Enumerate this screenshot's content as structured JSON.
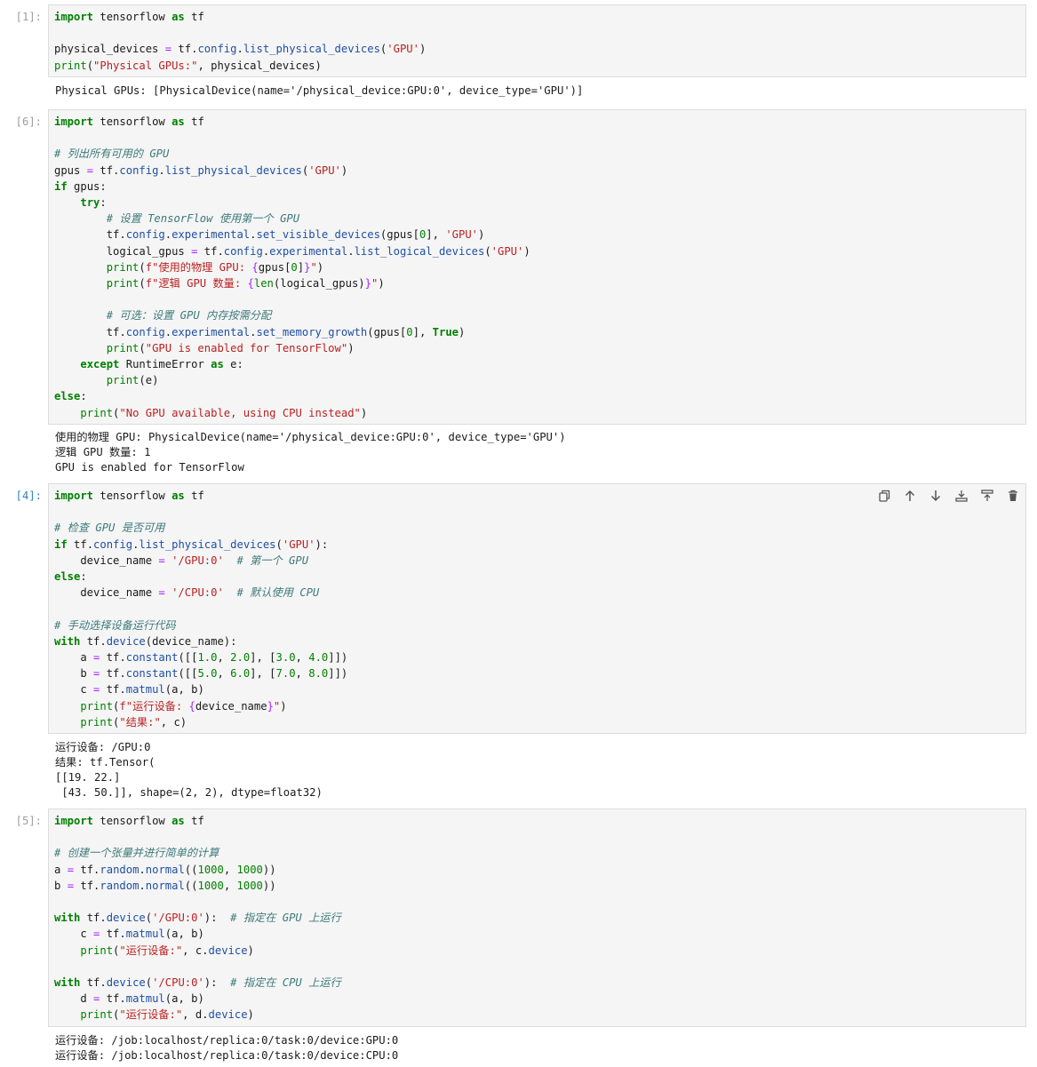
{
  "icons": {
    "copy": "copy-icon",
    "up": "arrow-up-icon",
    "down": "arrow-down-icon",
    "insert_above": "insert-above-icon",
    "insert_below": "insert-below-icon",
    "delete": "trash-icon"
  },
  "cells": [
    {
      "prompt": "[1]:",
      "active": false,
      "code": [
        [
          [
            "import",
            "kw"
          ],
          [
            " tensorflow ",
            ""
          ],
          [
            "as",
            "kw"
          ],
          [
            " tf",
            ""
          ]
        ],
        [],
        [
          [
            "physical_devices ",
            ""
          ],
          [
            "=",
            "op"
          ],
          [
            " tf.",
            ""
          ],
          [
            "config",
            "at"
          ],
          [
            ".",
            ""
          ],
          [
            "list_physical_devices",
            "at"
          ],
          [
            "(",
            ""
          ],
          [
            "'GPU'",
            "st"
          ],
          [
            ")",
            ""
          ]
        ],
        [
          [
            "print",
            "bi"
          ],
          [
            "(",
            ""
          ],
          [
            "\"Physical GPUs:\"",
            "st"
          ],
          [
            ", physical_devices)",
            ""
          ]
        ]
      ],
      "output": [
        "Physical GPUs: [PhysicalDevice(name='/physical_device:GPU:0', device_type='GPU')]"
      ]
    },
    {
      "prompt": "[6]:",
      "active": false,
      "code": [
        [
          [
            "import",
            "kw"
          ],
          [
            " tensorflow ",
            ""
          ],
          [
            "as",
            "kw"
          ],
          [
            " tf",
            ""
          ]
        ],
        [],
        [
          [
            "# 列出所有可用的 GPU",
            "cm"
          ]
        ],
        [
          [
            "gpus ",
            ""
          ],
          [
            "=",
            "op"
          ],
          [
            " tf.",
            ""
          ],
          [
            "config",
            "at"
          ],
          [
            ".",
            ""
          ],
          [
            "list_physical_devices",
            "at"
          ],
          [
            "(",
            ""
          ],
          [
            "'GPU'",
            "st"
          ],
          [
            ")",
            ""
          ]
        ],
        [
          [
            "if",
            "kw"
          ],
          [
            " gpus:",
            ""
          ]
        ],
        [
          [
            "    ",
            ""
          ],
          [
            "try",
            "kw"
          ],
          [
            ":",
            ""
          ]
        ],
        [
          [
            "        ",
            ""
          ],
          [
            "# 设置 TensorFlow 使用第一个 GPU",
            "cm"
          ]
        ],
        [
          [
            "        tf.",
            ""
          ],
          [
            "config",
            "at"
          ],
          [
            ".",
            ""
          ],
          [
            "experimental",
            "at"
          ],
          [
            ".",
            ""
          ],
          [
            "set_visible_devices",
            "at"
          ],
          [
            "(gpus[",
            ""
          ],
          [
            "0",
            "nu"
          ],
          [
            "], ",
            ""
          ],
          [
            "'GPU'",
            "st"
          ],
          [
            ")",
            ""
          ]
        ],
        [
          [
            "        logical_gpus ",
            ""
          ],
          [
            "=",
            "op"
          ],
          [
            " tf.",
            ""
          ],
          [
            "config",
            "at"
          ],
          [
            ".",
            ""
          ],
          [
            "experimental",
            "at"
          ],
          [
            ".",
            ""
          ],
          [
            "list_logical_devices",
            "at"
          ],
          [
            "(",
            ""
          ],
          [
            "'GPU'",
            "st"
          ],
          [
            ")",
            ""
          ]
        ],
        [
          [
            "        ",
            ""
          ],
          [
            "print",
            "bi"
          ],
          [
            "(",
            ""
          ],
          [
            "f\"使用的物理 GPU: ",
            "st"
          ],
          [
            "{",
            "op"
          ],
          [
            "gpus[",
            ""
          ],
          [
            "0",
            "nu"
          ],
          [
            "]",
            ""
          ],
          [
            "}",
            "op"
          ],
          [
            "\"",
            "st"
          ],
          [
            ")",
            ""
          ]
        ],
        [
          [
            "        ",
            ""
          ],
          [
            "print",
            "bi"
          ],
          [
            "(",
            ""
          ],
          [
            "f\"逻辑 GPU 数量: ",
            "st"
          ],
          [
            "{",
            "op"
          ],
          [
            "len",
            "bi"
          ],
          [
            "(logical_gpus)",
            ""
          ],
          [
            "}",
            "op"
          ],
          [
            "\"",
            "st"
          ],
          [
            ")",
            ""
          ]
        ],
        [],
        [
          [
            "        ",
            ""
          ],
          [
            "# 可选：设置 GPU 内存按需分配",
            "cm"
          ]
        ],
        [
          [
            "        tf.",
            ""
          ],
          [
            "config",
            "at"
          ],
          [
            ".",
            ""
          ],
          [
            "experimental",
            "at"
          ],
          [
            ".",
            ""
          ],
          [
            "set_memory_growth",
            "at"
          ],
          [
            "(gpus[",
            ""
          ],
          [
            "0",
            "nu"
          ],
          [
            "], ",
            ""
          ],
          [
            "True",
            "kw"
          ],
          [
            ")",
            ""
          ]
        ],
        [
          [
            "        ",
            ""
          ],
          [
            "print",
            "bi"
          ],
          [
            "(",
            ""
          ],
          [
            "\"GPU is enabled for TensorFlow\"",
            "st"
          ],
          [
            ")",
            ""
          ]
        ],
        [
          [
            "    ",
            ""
          ],
          [
            "except",
            "kw"
          ],
          [
            " RuntimeError ",
            ""
          ],
          [
            "as",
            "kw"
          ],
          [
            " e:",
            ""
          ]
        ],
        [
          [
            "        ",
            ""
          ],
          [
            "print",
            "bi"
          ],
          [
            "(e)",
            ""
          ]
        ],
        [
          [
            "else",
            "kw"
          ],
          [
            ":",
            ""
          ]
        ],
        [
          [
            "    ",
            ""
          ],
          [
            "print",
            "bi"
          ],
          [
            "(",
            ""
          ],
          [
            "\"No GPU available, using CPU instead\"",
            "st"
          ],
          [
            ")",
            ""
          ]
        ]
      ],
      "output": [
        "使用的物理 GPU: PhysicalDevice(name='/physical_device:GPU:0', device_type='GPU')",
        "逻辑 GPU 数量: 1",
        "GPU is enabled for TensorFlow"
      ]
    },
    {
      "prompt": "[4]:",
      "active": true,
      "code": [
        [
          [
            "import",
            "kw"
          ],
          [
            " tensorflow ",
            ""
          ],
          [
            "as",
            "kw"
          ],
          [
            " tf",
            ""
          ]
        ],
        [],
        [
          [
            "# 检查 GPU 是否可用",
            "cm"
          ]
        ],
        [
          [
            "if",
            "kw"
          ],
          [
            " tf.",
            ""
          ],
          [
            "config",
            "at"
          ],
          [
            ".",
            ""
          ],
          [
            "list_physical_devices",
            "at"
          ],
          [
            "(",
            ""
          ],
          [
            "'GPU'",
            "st"
          ],
          [
            "):",
            ""
          ]
        ],
        [
          [
            "    device_name ",
            ""
          ],
          [
            "=",
            "op"
          ],
          [
            " ",
            ""
          ],
          [
            "'/GPU:0'",
            "st"
          ],
          [
            "  ",
            ""
          ],
          [
            "# 第一个 GPU",
            "cm"
          ]
        ],
        [
          [
            "else",
            "kw"
          ],
          [
            ":",
            ""
          ]
        ],
        [
          [
            "    device_name ",
            ""
          ],
          [
            "=",
            "op"
          ],
          [
            " ",
            ""
          ],
          [
            "'/CPU:0'",
            "st"
          ],
          [
            "  ",
            ""
          ],
          [
            "# 默认使用 CPU",
            "cm"
          ]
        ],
        [],
        [
          [
            "# 手动选择设备运行代码",
            "cm"
          ]
        ],
        [
          [
            "with",
            "kw"
          ],
          [
            " tf.",
            ""
          ],
          [
            "device",
            "at"
          ],
          [
            "(device_name):",
            ""
          ]
        ],
        [
          [
            "    a ",
            ""
          ],
          [
            "=",
            "op"
          ],
          [
            " tf.",
            ""
          ],
          [
            "constant",
            "at"
          ],
          [
            "([[",
            ""
          ],
          [
            "1.0",
            "nu"
          ],
          [
            ", ",
            ""
          ],
          [
            "2.0",
            "nu"
          ],
          [
            "], [",
            ""
          ],
          [
            "3.0",
            "nu"
          ],
          [
            ", ",
            ""
          ],
          [
            "4.0",
            "nu"
          ],
          [
            "]])",
            ""
          ]
        ],
        [
          [
            "    b ",
            ""
          ],
          [
            "=",
            "op"
          ],
          [
            " tf.",
            ""
          ],
          [
            "constant",
            "at"
          ],
          [
            "([[",
            ""
          ],
          [
            "5.0",
            "nu"
          ],
          [
            ", ",
            ""
          ],
          [
            "6.0",
            "nu"
          ],
          [
            "], [",
            ""
          ],
          [
            "7.0",
            "nu"
          ],
          [
            ", ",
            ""
          ],
          [
            "8.0",
            "nu"
          ],
          [
            "]])",
            ""
          ]
        ],
        [
          [
            "    c ",
            ""
          ],
          [
            "=",
            "op"
          ],
          [
            " tf.",
            ""
          ],
          [
            "matmul",
            "at"
          ],
          [
            "(a, b)",
            ""
          ]
        ],
        [
          [
            "    ",
            ""
          ],
          [
            "print",
            "bi"
          ],
          [
            "(",
            ""
          ],
          [
            "f\"运行设备: ",
            "st"
          ],
          [
            "{",
            "op"
          ],
          [
            "device_name",
            ""
          ],
          [
            "}",
            "op"
          ],
          [
            "\"",
            "st"
          ],
          [
            ")",
            ""
          ]
        ],
        [
          [
            "    ",
            ""
          ],
          [
            "print",
            "bi"
          ],
          [
            "(",
            ""
          ],
          [
            "\"结果:\"",
            "st"
          ],
          [
            ", c)",
            ""
          ]
        ]
      ],
      "output": [
        "运行设备: /GPU:0",
        "结果: tf.Tensor(",
        "[[19. 22.]",
        " [43. 50.]], shape=(2, 2), dtype=float32)"
      ]
    },
    {
      "prompt": "[5]:",
      "active": false,
      "code": [
        [
          [
            "import",
            "kw"
          ],
          [
            " tensorflow ",
            ""
          ],
          [
            "as",
            "kw"
          ],
          [
            " tf",
            ""
          ]
        ],
        [],
        [
          [
            "# 创建一个张量并进行简单的计算",
            "cm"
          ]
        ],
        [
          [
            "a ",
            ""
          ],
          [
            "=",
            "op"
          ],
          [
            " tf.",
            ""
          ],
          [
            "random",
            "at"
          ],
          [
            ".",
            ""
          ],
          [
            "normal",
            "at"
          ],
          [
            "((",
            ""
          ],
          [
            "1000",
            "nu"
          ],
          [
            ", ",
            ""
          ],
          [
            "1000",
            "nu"
          ],
          [
            "))",
            ""
          ]
        ],
        [
          [
            "b ",
            ""
          ],
          [
            "=",
            "op"
          ],
          [
            " tf.",
            ""
          ],
          [
            "random",
            "at"
          ],
          [
            ".",
            ""
          ],
          [
            "normal",
            "at"
          ],
          [
            "((",
            ""
          ],
          [
            "1000",
            "nu"
          ],
          [
            ", ",
            ""
          ],
          [
            "1000",
            "nu"
          ],
          [
            "))",
            ""
          ]
        ],
        [],
        [
          [
            "with",
            "kw"
          ],
          [
            " tf.",
            ""
          ],
          [
            "device",
            "at"
          ],
          [
            "(",
            ""
          ],
          [
            "'/GPU:0'",
            "st"
          ],
          [
            "):  ",
            ""
          ],
          [
            "# 指定在 GPU 上运行",
            "cm"
          ]
        ],
        [
          [
            "    c ",
            ""
          ],
          [
            "=",
            "op"
          ],
          [
            " tf.",
            ""
          ],
          [
            "matmul",
            "at"
          ],
          [
            "(a, b)",
            ""
          ]
        ],
        [
          [
            "    ",
            ""
          ],
          [
            "print",
            "bi"
          ],
          [
            "(",
            ""
          ],
          [
            "\"运行设备:\"",
            "st"
          ],
          [
            ", c.",
            ""
          ],
          [
            "device",
            "at"
          ],
          [
            ")",
            ""
          ]
        ],
        [],
        [
          [
            "with",
            "kw"
          ],
          [
            " tf.",
            ""
          ],
          [
            "device",
            "at"
          ],
          [
            "(",
            ""
          ],
          [
            "'/CPU:0'",
            "st"
          ],
          [
            "):  ",
            ""
          ],
          [
            "# 指定在 CPU 上运行",
            "cm"
          ]
        ],
        [
          [
            "    d ",
            ""
          ],
          [
            "=",
            "op"
          ],
          [
            " tf.",
            ""
          ],
          [
            "matmul",
            "at"
          ],
          [
            "(a, b)",
            ""
          ]
        ],
        [
          [
            "    ",
            ""
          ],
          [
            "print",
            "bi"
          ],
          [
            "(",
            ""
          ],
          [
            "\"运行设备:\"",
            "st"
          ],
          [
            ", d.",
            ""
          ],
          [
            "device",
            "at"
          ],
          [
            ")",
            ""
          ]
        ]
      ],
      "output": [
        "运行设备: /job:localhost/replica:0/task:0/device:GPU:0",
        "运行设备: /job:localhost/replica:0/task:0/device:CPU:0"
      ]
    }
  ]
}
